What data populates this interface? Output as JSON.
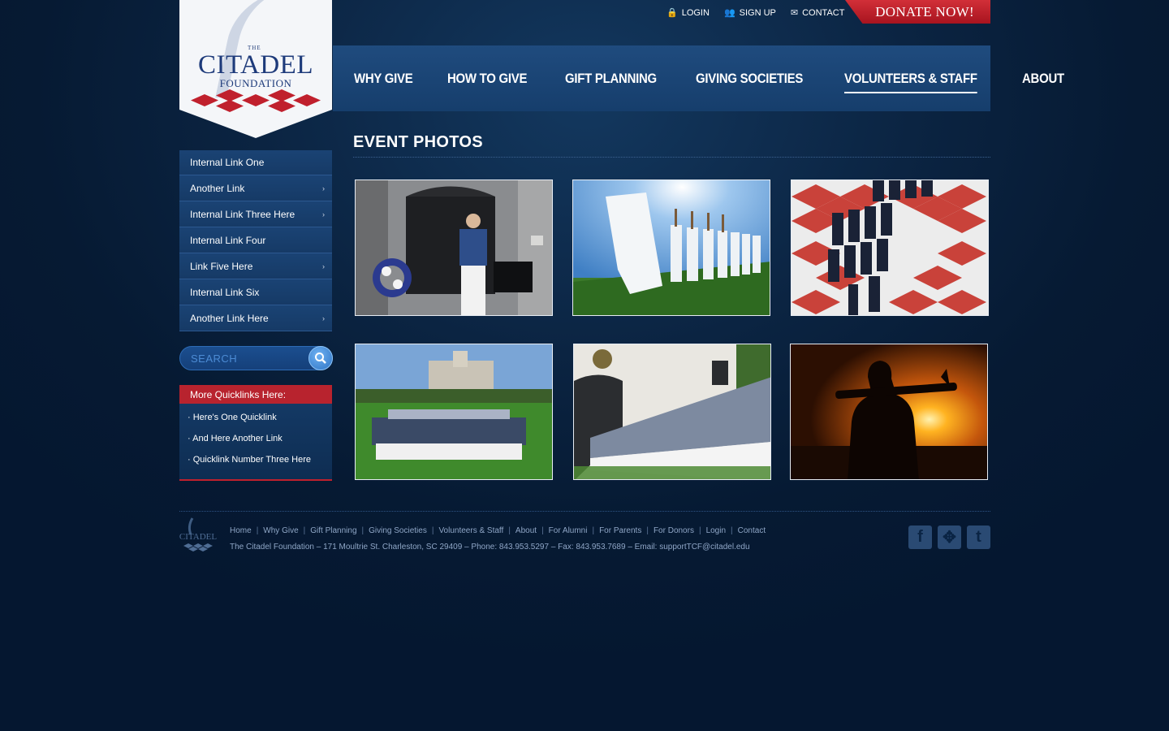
{
  "logo": {
    "the": "THE",
    "name": "CITADEL",
    "sub": "FOUNDATION"
  },
  "utility": [
    {
      "icon": "lock-icon",
      "glyph": "🔒",
      "label": "LOGIN"
    },
    {
      "icon": "users-icon",
      "glyph": "👥",
      "label": "SIGN UP"
    },
    {
      "icon": "envelope-icon",
      "glyph": "✉",
      "label": "CONTACT"
    }
  ],
  "donate_label": "DONATE NOW!",
  "nav": [
    "WHY GIVE",
    "HOW TO GIVE",
    "GIFT PLANNING",
    "GIVING SOCIETIES",
    "VOLUNTEERS & STAFF",
    "ABOUT"
  ],
  "nav_active": "VOLUNTEERS & STAFF",
  "sidebar": [
    {
      "label": "Internal Link One",
      "arrow": false
    },
    {
      "label": "Another Link",
      "arrow": true
    },
    {
      "label": "Internal Link Three Here",
      "arrow": true
    },
    {
      "label": "Internal Link Four",
      "arrow": false
    },
    {
      "label": "Link Five Here",
      "arrow": true
    },
    {
      "label": "Internal Link Six",
      "arrow": false
    },
    {
      "label": "Another Link Here",
      "arrow": true
    }
  ],
  "search": {
    "placeholder": "SEARCH"
  },
  "quicklinks": {
    "title": "More Quicklinks Here:",
    "items": [
      "· Here's One Quicklink",
      "· And Here Another Link",
      "· Quicklink Number Three Here"
    ]
  },
  "page_title": "EVENT PHOTOS",
  "photos": [
    {
      "name": "photo-memorial-bugler"
    },
    {
      "name": "photo-cadets-marching-low-angle"
    },
    {
      "name": "photo-cadets-checkerboard"
    },
    {
      "name": "photo-parade-field"
    },
    {
      "name": "photo-cadets-barracks-line"
    },
    {
      "name": "photo-sunset-silhouette"
    }
  ],
  "footer": {
    "links": [
      "Home",
      "Why Give",
      "Gift Planning",
      "Giving Societies",
      "Volunteers & Staff",
      "About",
      "For Alumni",
      "For Parents",
      "For Donors",
      "Login",
      "Contact"
    ],
    "address": "The Citadel Foundation – 171 Moultrie St. Charleston, SC 29409 – Phone: 843.953.5297 – Fax: 843.953.7689 – Email: supportTCF@citadel.edu",
    "logo_text": "CITADEL"
  },
  "social": [
    {
      "icon": "facebook-icon",
      "glyph": "f"
    },
    {
      "icon": "myspace-icon",
      "glyph": "✥"
    },
    {
      "icon": "twitter-icon",
      "glyph": "t"
    }
  ]
}
